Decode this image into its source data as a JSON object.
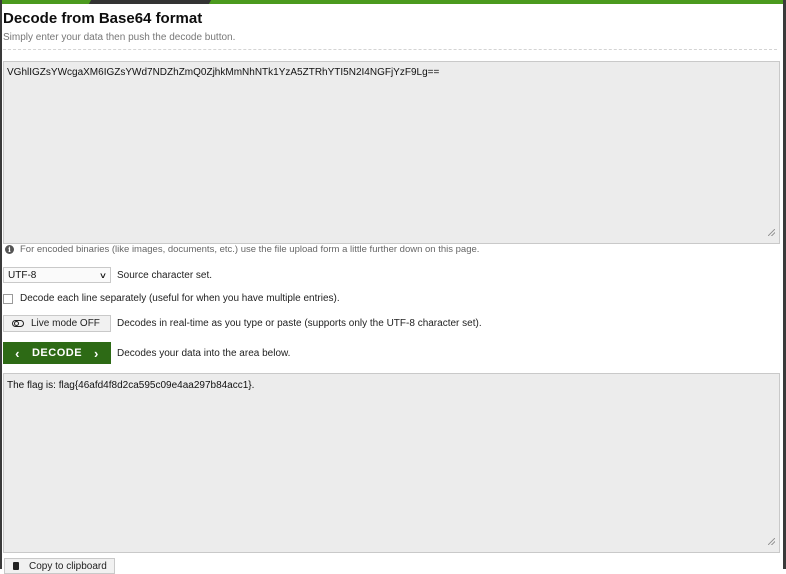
{
  "header": {
    "title": "Decode from Base64 format",
    "subtitle": "Simply enter your data then push the decode button."
  },
  "input": {
    "value": "VGhlIGZsYWcgaXM6IGZsYWd7NDZhZmQ0ZjhkMmNhNTk1YzA5ZTRhYTI5N2I4NGFjYzF9Lg=="
  },
  "info": {
    "icon": "info-circle-icon",
    "text": "For encoded binaries (like images, documents, etc.) use the file upload form a little further down on this page."
  },
  "charset": {
    "selected": "UTF-8",
    "label": "Source character set."
  },
  "options": {
    "lines_label": "Decode each line separately (useful for when you have multiple entries).",
    "live_button": "Live mode OFF",
    "live_label": "Decodes in real-time as you type or paste (supports only the UTF-8 character set)."
  },
  "decode": {
    "button": "DECODE",
    "label": "Decodes your data into the area below."
  },
  "output": {
    "value": "The flag is: flag{46afd4f8d2ca595c09e4aa297b84acc1}."
  },
  "copy": {
    "button": "Copy to clipboard"
  },
  "colors": {
    "accent": "#4b9a1e",
    "button": "#2d6a15"
  }
}
